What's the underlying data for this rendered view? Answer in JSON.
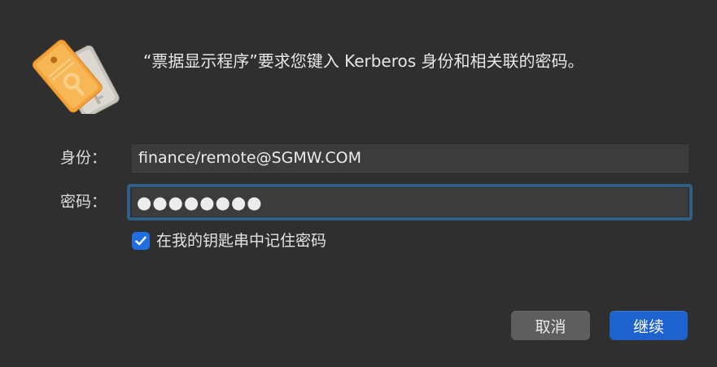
{
  "dialog": {
    "message": "“票据显示程序”要求您键入 Kerberos 身份和相关联的密码。",
    "app_icon": "keychain-tickets-icon"
  },
  "form": {
    "identity_label": "身份：",
    "identity_value": "finance/remote@SGMW.COM",
    "password_label": "密码：",
    "password_value": "●●●●●●●●",
    "remember_checked": true,
    "remember_label": "在我的钥匙串中记住密码"
  },
  "buttons": {
    "cancel_label": "取消",
    "continue_label": "继续"
  },
  "colors": {
    "background": "#302f2f",
    "accent": "#1d62cf",
    "focus_ring": "#2f5f86",
    "checkbox": "#1f6fe0"
  }
}
